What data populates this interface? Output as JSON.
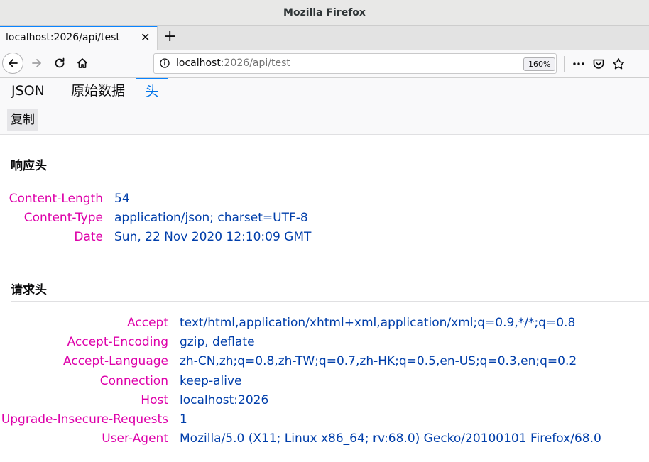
{
  "window": {
    "title": "Mozilla Firefox"
  },
  "tab": {
    "title": "localhost:2026/api/test",
    "close_glyph": "✕",
    "new_tab_glyph": "+"
  },
  "urlbar": {
    "host": "localhost",
    "path": ":2026/api/test",
    "zoom": "160%"
  },
  "icons": {
    "back": "arrow-left-icon",
    "forward": "arrow-right-icon",
    "reload": "reload-icon",
    "home": "home-icon",
    "info": "info-icon",
    "more": "ellipsis-icon",
    "pocket": "pocket-icon",
    "bookmark": "star-icon"
  },
  "viewer": {
    "tabs": [
      {
        "label": "JSON"
      },
      {
        "label": "原始数据"
      },
      {
        "label": "头"
      }
    ],
    "active_tab": "头",
    "copy_label": "复制"
  },
  "response_headers": {
    "title": "响应头",
    "rows": [
      {
        "name": "Content-Length",
        "value": "54"
      },
      {
        "name": "Content-Type",
        "value": "application/json; charset=UTF-8"
      },
      {
        "name": "Date",
        "value": "Sun, 22 Nov 2020 12:10:09 GMT"
      }
    ]
  },
  "request_headers": {
    "title": "请求头",
    "rows": [
      {
        "name": "Accept",
        "value": "text/html,application/xhtml+xml,application/xml;q=0.9,*/*;q=0.8"
      },
      {
        "name": "Accept-Encoding",
        "value": "gzip, deflate"
      },
      {
        "name": "Accept-Language",
        "value": "zh-CN,zh;q=0.8,zh-TW;q=0.7,zh-HK;q=0.5,en-US;q=0.3,en;q=0.2"
      },
      {
        "name": "Connection",
        "value": "keep-alive"
      },
      {
        "name": "Host",
        "value": "localhost:2026"
      },
      {
        "name": "Upgrade-Insecure-Requests",
        "value": "1"
      },
      {
        "name": "User-Agent",
        "value": "Mozilla/5.0 (X11; Linux x86_64; rv:68.0) Gecko/20100101 Firefox/68.0"
      }
    ]
  },
  "colors": {
    "header_name": "#dd00a9",
    "header_value": "#003eaa",
    "accent": "#0a84ff"
  }
}
